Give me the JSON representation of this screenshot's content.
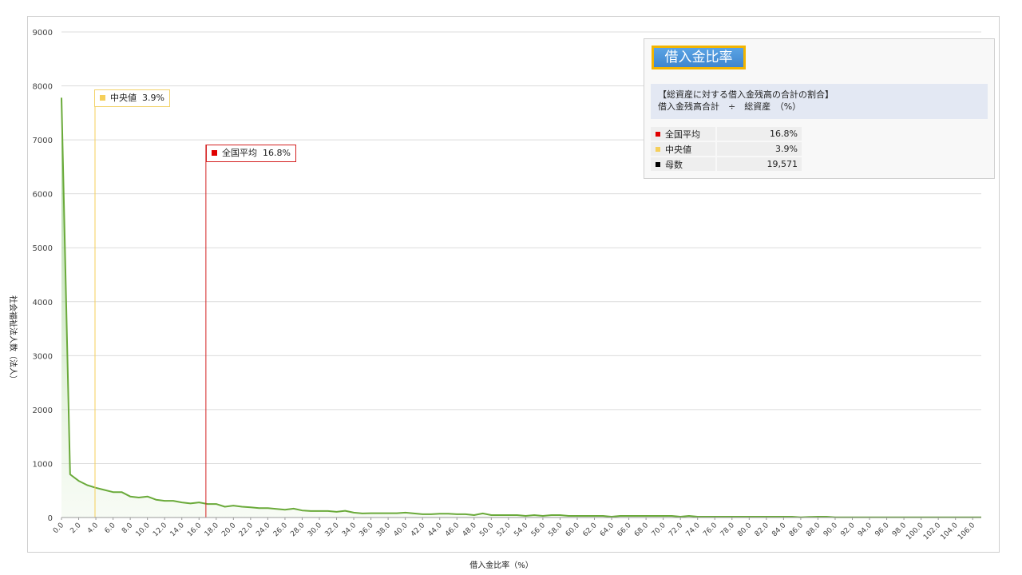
{
  "chart_data": {
    "type": "area",
    "title": "借入金比率",
    "description_line1": "【総資産に対する借入金残高の合計の割合】",
    "description_line2": "借入金残高合計　÷　総資産　（%）",
    "xlabel": "借入金比率（%）",
    "ylabel": "社会福祉法人数（法人）",
    "ylim": [
      0,
      9000
    ],
    "yticks": [
      "0",
      "1000",
      "2000",
      "3000",
      "4000",
      "5000",
      "6000",
      "7000",
      "8000",
      "9000"
    ],
    "xlim": [
      0,
      107
    ],
    "xticks": [
      "0.0",
      "2.0",
      "4.0",
      "6.0",
      "8.0",
      "10.0",
      "12.0",
      "14.0",
      "16.0",
      "18.0",
      "20.0",
      "22.0",
      "24.0",
      "26.0",
      "28.0",
      "30.0",
      "32.0",
      "34.0",
      "36.0",
      "38.0",
      "40.0",
      "42.0",
      "44.0",
      "46.0",
      "48.0",
      "50.0",
      "52.0",
      "54.0",
      "56.0",
      "58.0",
      "60.0",
      "62.0",
      "64.0",
      "66.0",
      "68.0",
      "70.0",
      "72.0",
      "74.0",
      "76.0",
      "78.0",
      "80.0",
      "82.0",
      "84.0",
      "86.0",
      "88.0",
      "90.0",
      "92.0",
      "94.0",
      "96.0",
      "98.0",
      "100.0",
      "102.0",
      "104.0",
      "106.0"
    ],
    "series": [
      {
        "color": "#6aaa3a",
        "x": [
          0,
          1,
          2,
          3,
          4,
          5,
          6,
          7,
          8,
          9,
          10,
          11,
          12,
          13,
          14,
          15,
          16,
          17,
          18,
          19,
          20,
          21,
          22,
          23,
          24,
          25,
          26,
          27,
          28,
          29,
          30,
          31,
          32,
          33,
          34,
          35,
          36,
          37,
          38,
          39,
          40,
          41,
          42,
          43,
          44,
          45,
          46,
          47,
          48,
          49,
          50,
          51,
          52,
          53,
          54,
          55,
          56,
          57,
          58,
          59,
          60,
          61,
          62,
          63,
          64,
          65,
          66,
          67,
          68,
          69,
          70,
          71,
          72,
          73,
          74,
          75,
          76,
          77,
          78,
          79,
          80,
          81,
          82,
          83,
          84,
          85,
          86,
          87,
          88,
          89,
          90,
          91,
          92,
          93,
          94,
          95,
          96,
          97,
          98,
          99,
          100,
          101,
          102,
          103,
          104,
          105,
          106,
          107
        ],
        "values": [
          7780,
          800,
          680,
          600,
          550,
          510,
          470,
          470,
          390,
          370,
          390,
          330,
          310,
          310,
          280,
          260,
          280,
          250,
          250,
          200,
          220,
          200,
          190,
          175,
          175,
          160,
          145,
          165,
          130,
          120,
          120,
          120,
          105,
          125,
          90,
          75,
          80,
          80,
          80,
          80,
          90,
          75,
          60,
          60,
          70,
          70,
          60,
          60,
          45,
          75,
          45,
          45,
          45,
          45,
          30,
          45,
          30,
          45,
          45,
          30,
          30,
          30,
          30,
          30,
          15,
          30,
          30,
          30,
          30,
          30,
          30,
          30,
          15,
          30,
          15,
          15,
          15,
          15,
          15,
          15,
          15,
          15,
          15,
          15,
          15,
          15,
          5,
          10,
          15,
          15,
          5,
          5,
          5,
          5,
          5,
          5,
          5,
          5,
          5,
          5,
          5,
          5,
          5,
          5,
          5,
          5,
          5,
          5
        ]
      }
    ],
    "reference_lines": [
      {
        "name": "中央値",
        "value": 3.9,
        "value_text": "3.9%",
        "color": "#f5cf5a"
      },
      {
        "name": "全国平均",
        "value": 16.8,
        "value_text": "16.8%",
        "color": "#d42121"
      }
    ],
    "stats": [
      {
        "label": "全国平均",
        "value": "16.8%",
        "color": "#e00000"
      },
      {
        "label": "中央値",
        "value": "3.9%",
        "color": "#f5cf5a"
      },
      {
        "label": "母数",
        "value": "19,571",
        "color": "#000000"
      }
    ],
    "grid": true
  }
}
